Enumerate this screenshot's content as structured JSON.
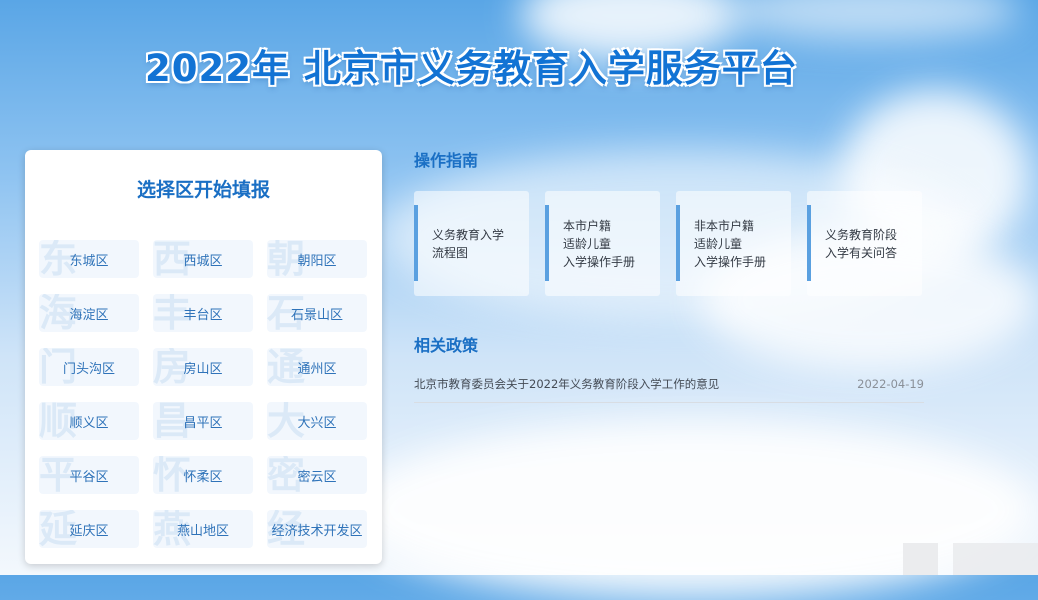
{
  "header": {
    "title": "2022年 北京市义务教育入学服务平台"
  },
  "district_panel": {
    "title": "选择区开始填报",
    "districts": [
      {
        "label": "东城区",
        "watermark": "东"
      },
      {
        "label": "西城区",
        "watermark": "西"
      },
      {
        "label": "朝阳区",
        "watermark": "朝"
      },
      {
        "label": "海淀区",
        "watermark": "海"
      },
      {
        "label": "丰台区",
        "watermark": "丰"
      },
      {
        "label": "石景山区",
        "watermark": "石"
      },
      {
        "label": "门头沟区",
        "watermark": "门"
      },
      {
        "label": "房山区",
        "watermark": "房"
      },
      {
        "label": "通州区",
        "watermark": "通"
      },
      {
        "label": "顺义区",
        "watermark": "顺"
      },
      {
        "label": "昌平区",
        "watermark": "昌"
      },
      {
        "label": "大兴区",
        "watermark": "大"
      },
      {
        "label": "平谷区",
        "watermark": "平"
      },
      {
        "label": "怀柔区",
        "watermark": "怀"
      },
      {
        "label": "密云区",
        "watermark": "密"
      },
      {
        "label": "延庆区",
        "watermark": "延"
      },
      {
        "label": "燕山地区",
        "watermark": "燕"
      },
      {
        "label": "经济技术开发区",
        "watermark": "经"
      }
    ]
  },
  "guide": {
    "title": "操作指南",
    "cards": [
      {
        "text": "义务教育入学\n流程图"
      },
      {
        "text": "本市户籍\n适龄儿童\n入学操作手册"
      },
      {
        "text": "非本市户籍\n适龄儿童\n入学操作手册"
      },
      {
        "text": "义务教育阶段\n入学有关问答"
      }
    ]
  },
  "policy": {
    "title": "相关政策",
    "items": [
      {
        "text": "北京市教育委员会关于2022年义务教育阶段入学工作的意见",
        "date": "2022-04-19"
      }
    ]
  }
}
